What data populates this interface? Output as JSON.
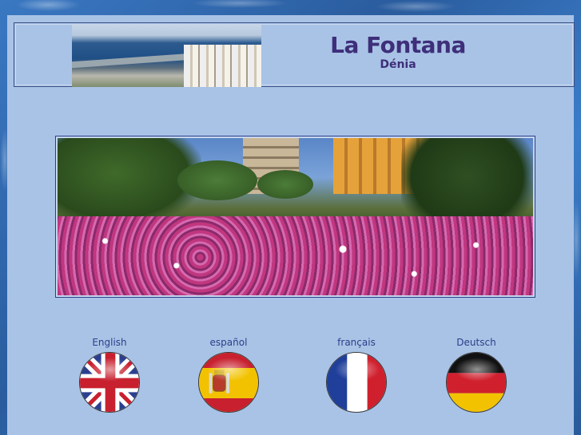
{
  "header": {
    "title": "La Fontana",
    "subtitle": "Dénia"
  },
  "languages": [
    {
      "label": "English",
      "flag": "uk-flag-icon"
    },
    {
      "label": "español",
      "flag": "spain-flag-icon"
    },
    {
      "label": "français",
      "flag": "france-flag-icon"
    },
    {
      "label": "Deutsch",
      "flag": "germany-flag-icon"
    }
  ],
  "colors": {
    "page_background": "#a9c3e6",
    "title": "#3e2f7a",
    "link": "#2b3f8a"
  }
}
